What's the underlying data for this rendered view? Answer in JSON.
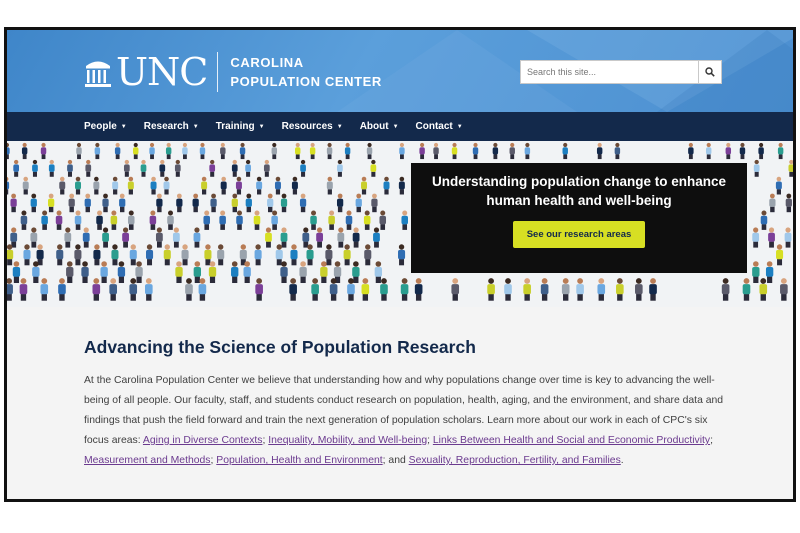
{
  "header": {
    "logo_text": "UNC",
    "center_name_line1": "CAROLINA",
    "center_name_line2": "POPULATION CENTER",
    "search_placeholder": "Search this site...",
    "search_icon": "search-icon"
  },
  "nav": {
    "items": [
      {
        "label": "People"
      },
      {
        "label": "Research"
      },
      {
        "label": "Training"
      },
      {
        "label": "Resources"
      },
      {
        "label": "About"
      },
      {
        "label": "Contact"
      }
    ]
  },
  "hero": {
    "title": "Understanding population change to enhance human health and well-being",
    "button_label": "See our research areas"
  },
  "main": {
    "title": "Advancing the Science of Population Research",
    "intro": "At the Carolina Population Center we believe that understanding how and why populations change over time is key to advancing the well-being of all people. Our faculty, staff, and students conduct research on population, health, aging, and the environment, and share data and findings that push the field forward and train the next generation of population scholars. Learn more about our work in each of CPC's six focus areas: ",
    "links": [
      "Aging in Diverse Contexts",
      "Inequality, Mobility, and Well-being",
      "Links Between Health and Social and Economic Productivity",
      "Measurement and Methods",
      "Population, Health and Environment",
      "Sexuality, Reproduction, Fertility, and Families"
    ],
    "separator": "; ",
    "last_separator": "; and ",
    "end": "."
  },
  "colors": {
    "header_blue": "#4b8fd2",
    "nav_navy": "#13294b",
    "button_yellow": "#d7df23",
    "link_purple": "#6b3a8f",
    "title_navy": "#13294b"
  }
}
